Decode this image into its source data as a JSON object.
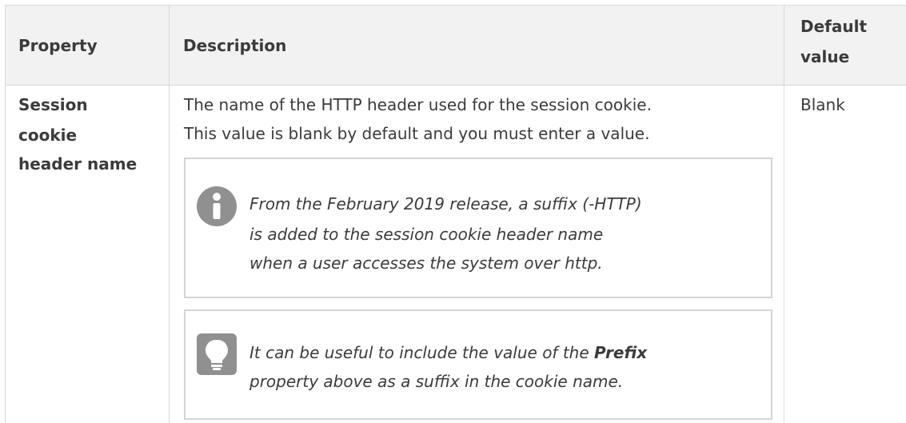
{
  "table": {
    "headers": {
      "property": "Property",
      "description": "Description",
      "default_line1": "Default",
      "default_line2": "value"
    },
    "row": {
      "property_line1": "Session",
      "property_line2": "cookie",
      "property_line3": "header name",
      "description_line1": "The name of the HTTP header used for the session cookie.",
      "description_line2": "This value is blank by default and you must enter a value.",
      "default": "Blank"
    },
    "info_note": {
      "icon": "info-icon",
      "line1": "From the February 2019 release, a suffix (-HTTP)",
      "line2": "is added to the session cookie header name",
      "line3": "when a user accesses the system over http."
    },
    "tip_note": {
      "icon": "lightbulb-icon",
      "line1_pre": "It can be useful to include the value of the ",
      "line1_bold": "Prefix",
      "line2": "property above as a suffix in the cookie name."
    }
  }
}
